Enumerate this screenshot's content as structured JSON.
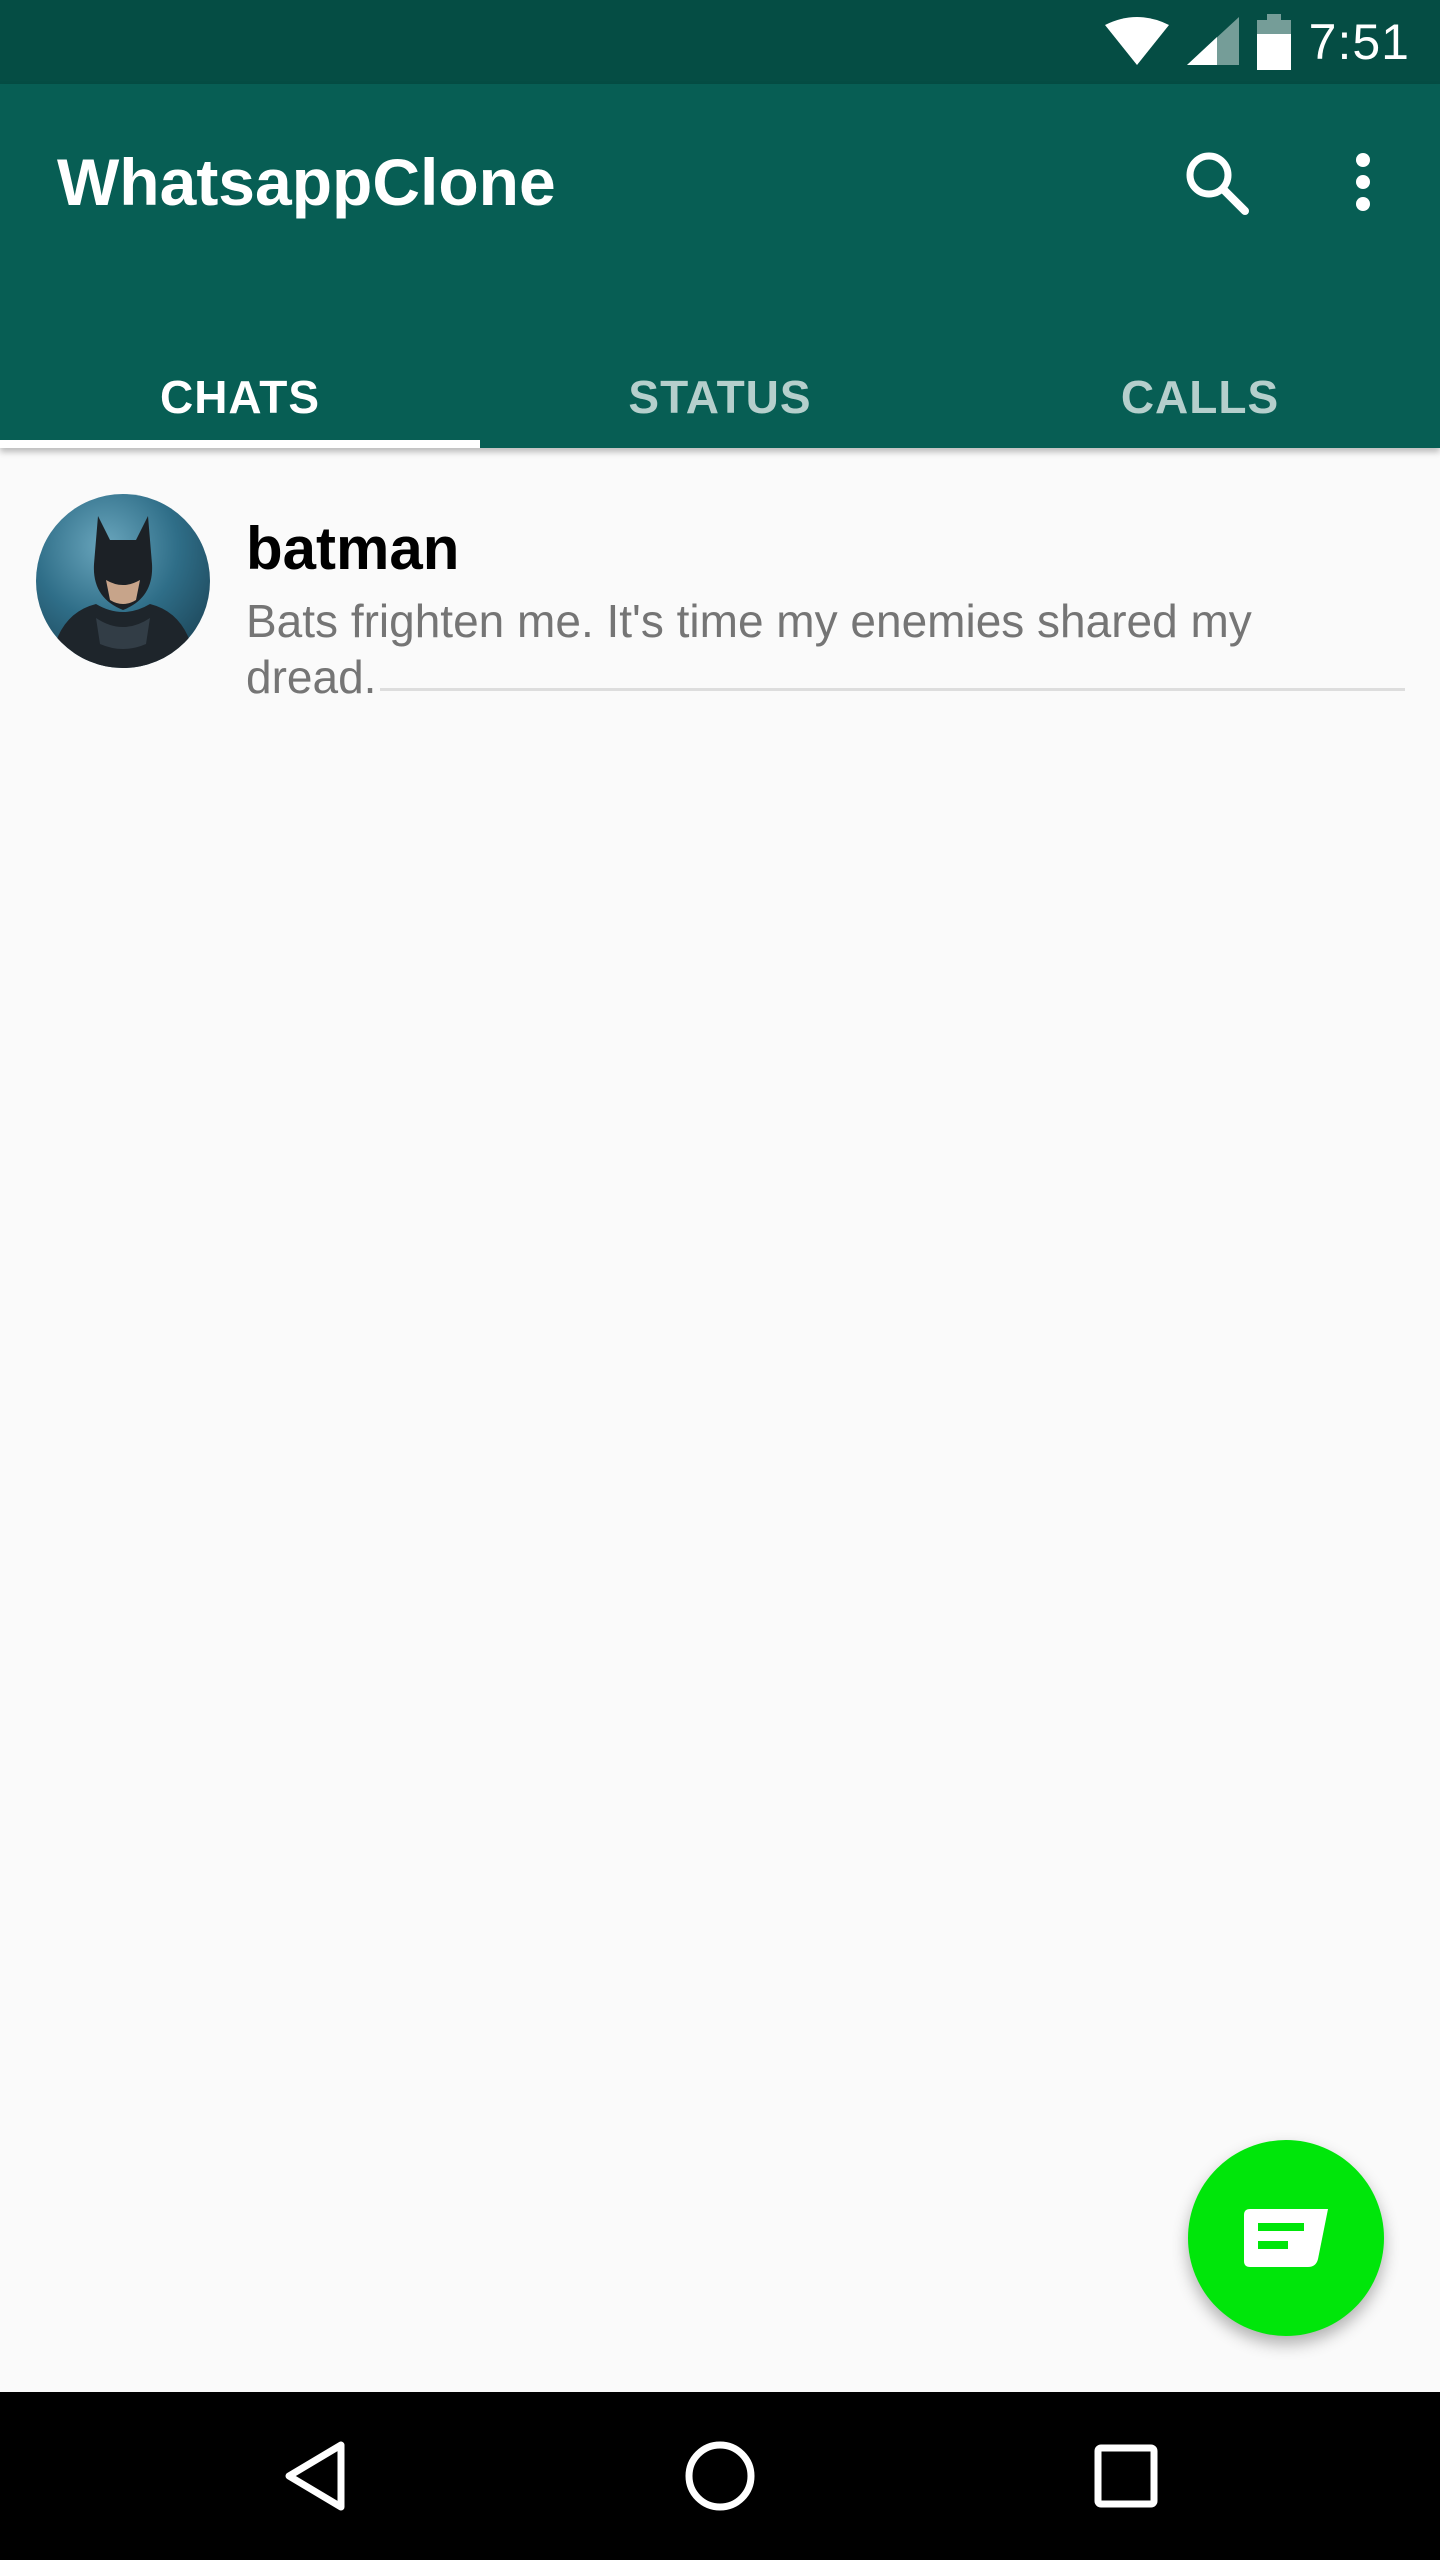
{
  "status_bar": {
    "time": "7:51"
  },
  "app_bar": {
    "title": "WhatsappClone"
  },
  "tabs": [
    {
      "label": "CHATS",
      "active": true
    },
    {
      "label": "STATUS",
      "active": false
    },
    {
      "label": "CALLS",
      "active": false
    }
  ],
  "chats": [
    {
      "name": "batman",
      "message": "Bats frighten me. It's time my enemies shared my dread."
    }
  ],
  "colors": {
    "status_bar": "#054d44",
    "toolbar": "#075e54",
    "fab": "#00e60a",
    "background": "#fafafa"
  },
  "icons": {
    "search": "search-icon",
    "more": "more-vert-icon",
    "fab": "new-chat-icon",
    "nav_back": "back-triangle-icon",
    "nav_home": "home-circle-icon",
    "nav_recents": "recents-square-icon"
  }
}
